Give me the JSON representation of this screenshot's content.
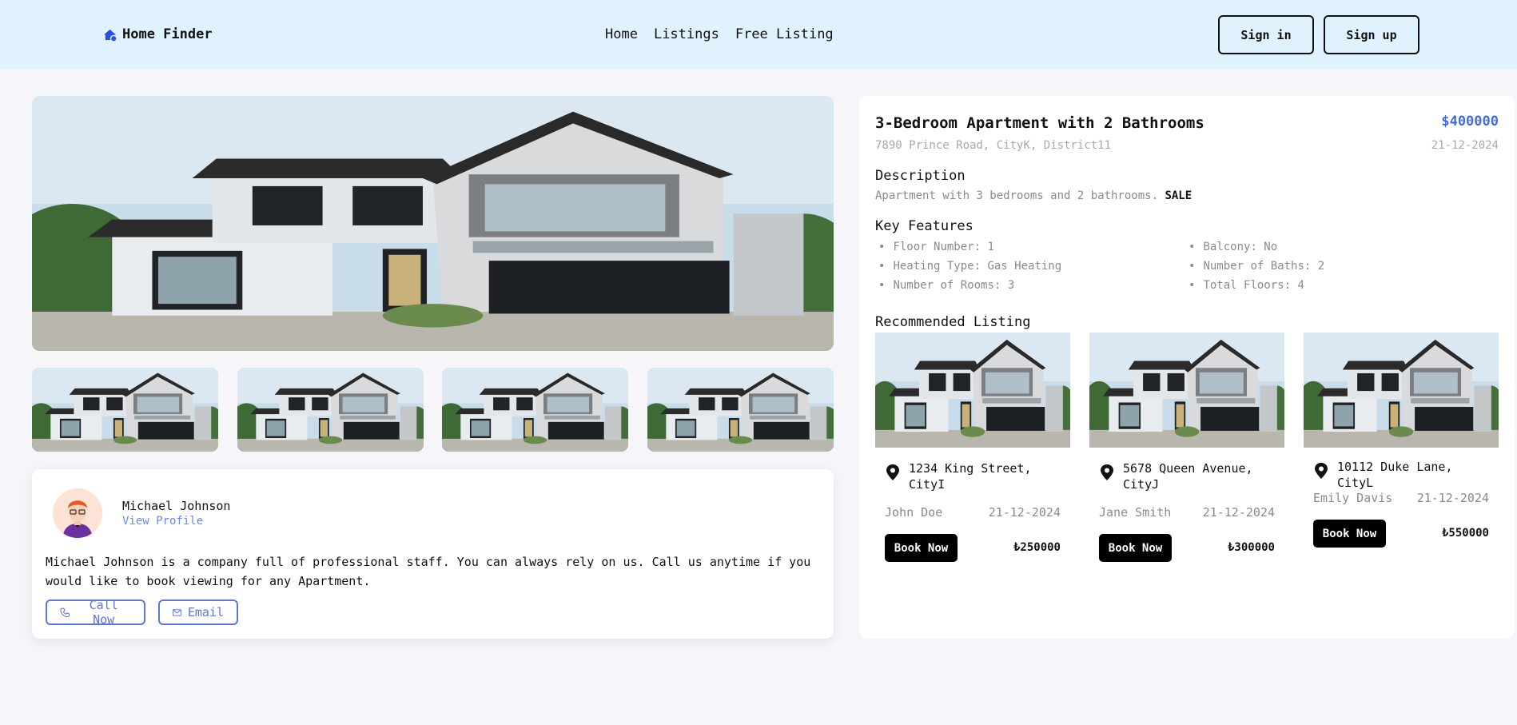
{
  "header": {
    "brand": "Home Finder",
    "nav": [
      "Home",
      "Listings",
      "Free Listing"
    ],
    "sign_in": "Sign in",
    "sign_up": "Sign up"
  },
  "listing": {
    "title": "3-Bedroom Apartment with 2 Bathrooms",
    "price": "$400000",
    "address": "7890 Prince Road, CityK, District11",
    "date": "21-12-2024",
    "description_heading": "Description",
    "description": "Apartment with 3 bedrooms and 2 bathrooms.",
    "status": "SALE",
    "features_heading": "Key Features",
    "features": [
      "Floor Number: 1",
      "Heating Type: Gas Heating",
      "Number of Rooms: 3",
      "Balcony: No",
      "Number of Baths: 2",
      "Total Floors: 4"
    ],
    "recommended_heading": "Recommended Listing"
  },
  "agent": {
    "name": "Michael Johnson",
    "profile_link": "View Profile",
    "description": "Michael Johnson is a company full of professional staff. You can always rely on us. Call us anytime if you would like to book viewing for any Apartment.",
    "call_label": "Call Now",
    "email_label": "Email"
  },
  "recommended": [
    {
      "address": "1234 King Street, CityI",
      "agent": "John Doe",
      "date": "21-12-2024",
      "button": "Book Now",
      "price": "₺250000"
    },
    {
      "address": "5678 Queen Avenue, CityJ",
      "agent": "Jane Smith",
      "date": "21-12-2024",
      "button": "Book Now",
      "price": "₺300000"
    },
    {
      "address": "10112 Duke Lane, CityL",
      "agent": "Emily Davis",
      "date": "21-12-2024",
      "button": "Book Now",
      "price": "₺550000"
    }
  ],
  "colors": {
    "header_bg": "#e0f2fe",
    "accent": "#4169e1",
    "outline_button": "#5b75e6",
    "page_bg": "#f6f6fa"
  }
}
